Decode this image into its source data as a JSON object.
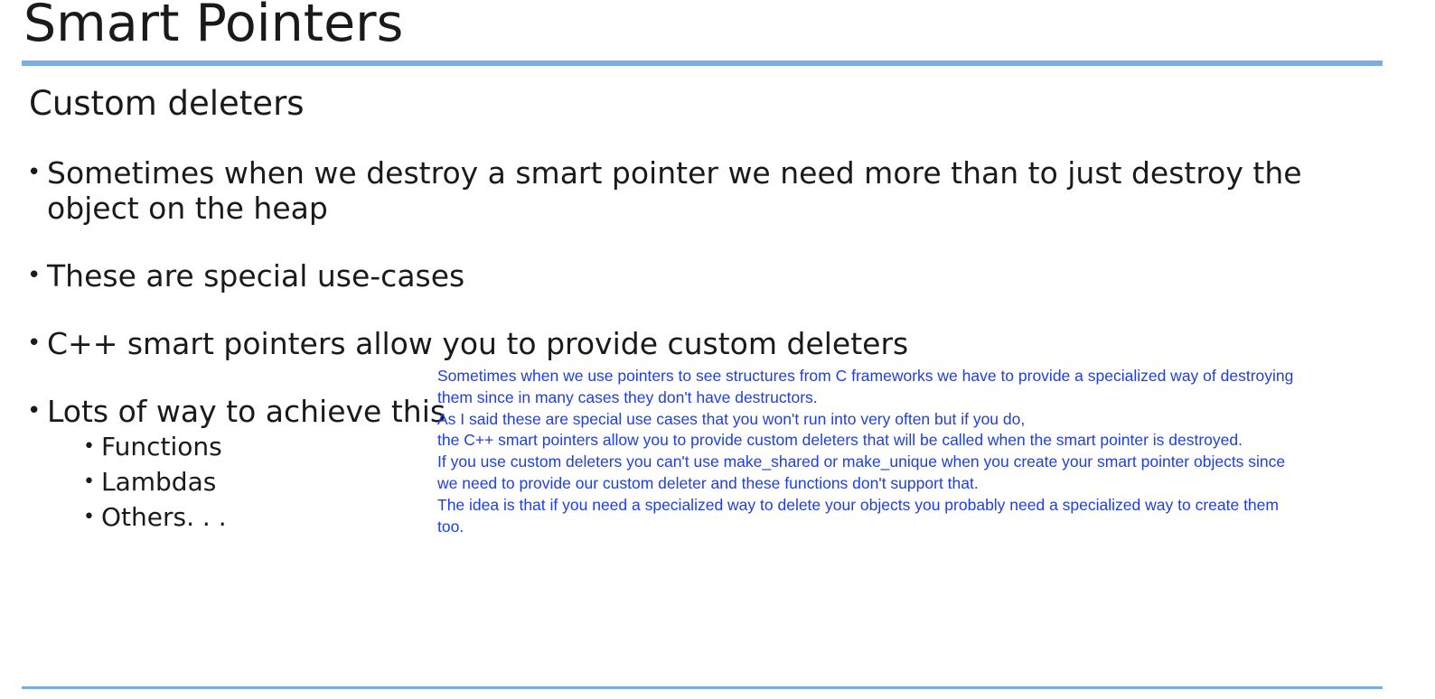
{
  "slide": {
    "title": "Smart Pointers",
    "subtitle": "Custom deleters",
    "bullets": [
      "Sometimes when we destroy a smart pointer we need more than to just destroy the object on the heap",
      "These are special use-cases",
      "C++ smart pointers allow you to provide custom deleters",
      "Lots of way to achieve this"
    ],
    "sub_bullets": [
      "Functions",
      "Lambdas",
      "Others. . ."
    ],
    "bullet_glyph": "•"
  },
  "notes": {
    "paragraphs": [
      "Sometimes when we use pointers to see structures from C frameworks we have to provide a specialized way of destroying them since in many cases they don't have destructors.",
      "As I said these are special use cases that you won't run into very often but if you do,",
      "the C++ smart pointers allow you to provide custom deleters that will be called when the smart pointer is destroyed.",
      "If you use custom deleters you can't use make_shared or make_unique when you create your smart pointer objects since we need to provide our custom deleter and these functions don't support that.",
      "The idea is that if you need a specialized way to delete your objects you probably need a specialized way to create them too."
    ]
  },
  "colors": {
    "rule": "#7aaee3",
    "notes_text": "#1f3fe0",
    "body_text": "#1a1a1a"
  }
}
